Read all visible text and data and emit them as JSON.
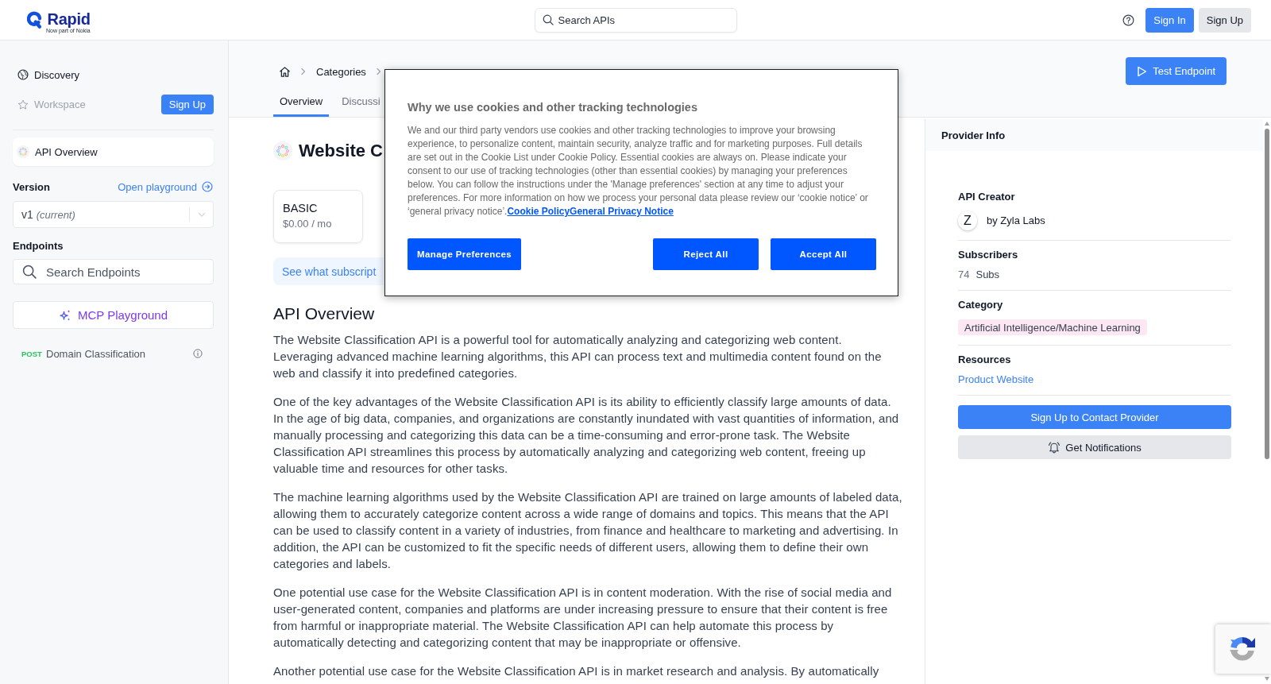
{
  "header": {
    "logo": {
      "name": "Rapid",
      "tagline": "Now part of Nokia"
    },
    "search": {
      "placeholder": "Search APIs"
    },
    "buttons": [
      {
        "label": "Sign In",
        "kind": "primary"
      },
      {
        "label": "Sign Up",
        "kind": "secondary"
      }
    ]
  },
  "sidebar": {
    "nav": [
      {
        "kind": "discovery",
        "label": "Discovery",
        "disabled": false
      },
      {
        "kind": "workspace",
        "label": "Workspace",
        "disabled": true
      }
    ],
    "signup_button": "Sign Up",
    "api_overview": {
      "label": "API Overview",
      "selected": true
    },
    "version": {
      "label": "Version",
      "link": "Open playground",
      "value": "v1 *(current)*"
    },
    "endpoints": {
      "label": "Endpoints",
      "search": {
        "placeholder": "Search Endpoints"
      },
      "mcp_button": "MCP Playground",
      "items": [
        {
          "method": "POST",
          "color": "#22c55e",
          "name": "Domain Classification"
        }
      ]
    }
  },
  "topbar": {
    "breadcrumb": [
      "Categories"
    ],
    "tabs": [
      {
        "label": "Overview",
        "selected": true
      },
      {
        "label": "Discussi",
        "selected": false
      }
    ],
    "action_button": "Test Endpoint"
  },
  "api": {
    "title": "Website C",
    "plans": [
      {
        "name": "BASIC",
        "price": "$0.00 / mo"
      }
    ],
    "plans_note": "See what subscript",
    "overview_heading": "API Overview",
    "paragraphs": [
      "The Website Classification API is a powerful tool for automatically analyzing and categorizing web content. Leveraging advanced machine learning algorithms, this API can process text and multimedia content found on the web and classify it into predefined categories.",
      "One of the key advantages of the Website Classification API is its ability to efficiently classify large amounts of data. In the age of big data, companies, and organizations are constantly inundated with vast quantities of information, and manually processing and categorizing this data can be a time-consuming and error-prone task. The Website Classification API streamlines this process by automatically analyzing and categorizing web content, freeing up valuable time and resources for other tasks.",
      "The machine learning algorithms used by the Website Classification API are trained on large amounts of labeled data, allowing them to accurately categorize content across a wide range of domains and topics. This means that the API can be used to classify content in a variety of industries, from finance and healthcare to marketing and advertising. In addition, the API can be customized to fit the specific needs of different users, allowing them to define their own categories and labels.",
      "One potential use case for the Website Classification API is in content moderation. With the rise of social media and user-generated content, companies and platforms are under increasing pressure to ensure that their content is free from harmful or inappropriate material. The Website Classification API can help automate this process by automatically detecting and categorizing content that may be inappropriate or offensive.",
      "Another potential use case for the Website Classification API is in market research and analysis. By automatically"
    ]
  },
  "provider": {
    "title": "Provider Info",
    "sections": [
      {
        "kind": "creator",
        "label": "API Creator",
        "initial": "Z",
        "name": "by Zyla Labs"
      },
      {
        "kind": "count",
        "label": "Subscribers",
        "count": "74",
        "unit": "Subs"
      },
      {
        "kind": "tag",
        "label": "Category",
        "tag": "Artificial Intelligence/Machine Learning"
      },
      {
        "kind": "links",
        "label": "Resources",
        "links": [
          "Product Website"
        ]
      }
    ],
    "buttons": [
      {
        "label": "Sign Up to Contact Provider",
        "kind": "primary"
      },
      {
        "label": "Get Notifications",
        "kind": "notify"
      }
    ]
  },
  "cookie_dialog": {
    "title": "Why we use cookies and other tracking technologies",
    "body": "We and our third party vendors use cookies and other tracking technologies to improve your browsing experience, to personalize content, maintain security, analyze traffic and for marketing purposes. Full details are set out in the Cookie List under Cookie Policy. Essential cookies are always on. Please indicate your consent to our use of tracking technologies (other than essential cookies) by managing your preferences below. You can follow the instructions under the 'Manage preferences' section at any time to adjust your preferences. For more information on how we process your personal data please review our ‘cookie notice’ or ‘general privacy notice’.",
    "links": [
      "Cookie Policy",
      "General Privacy Notice"
    ],
    "buttons": [
      {
        "label": "Manage Preferences",
        "kind": "manage"
      },
      {
        "label": "Reject All",
        "kind": "reject"
      },
      {
        "label": "Accept All",
        "kind": "accept"
      }
    ]
  }
}
